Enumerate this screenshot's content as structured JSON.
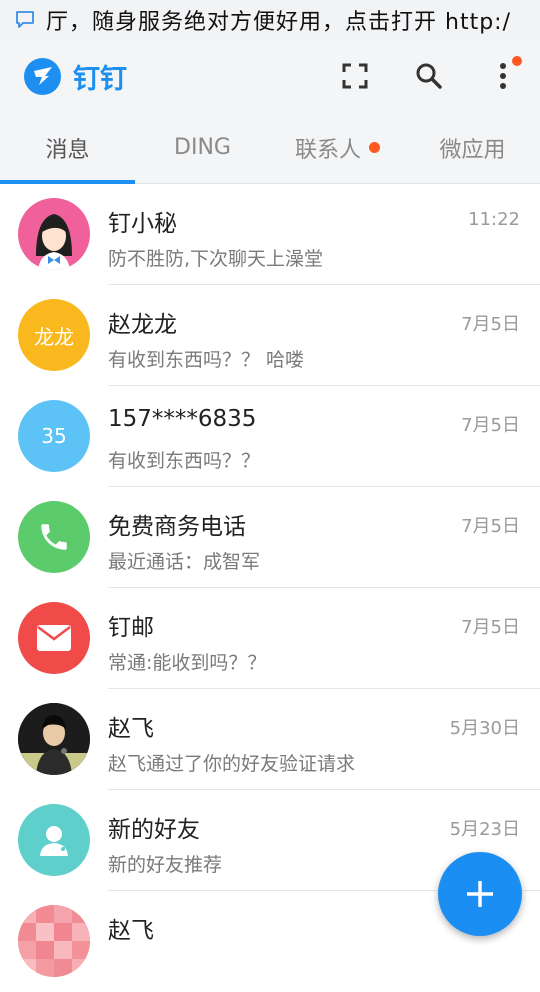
{
  "notification": {
    "text": "厅，随身服务绝对方便好用，点击打开 http:/",
    "icon": "chat-bubble-icon"
  },
  "appbar": {
    "title": "钉钉",
    "actions": [
      "fullscreen-icon",
      "search-icon",
      "more-vert-icon"
    ]
  },
  "tabs": [
    {
      "label": "消息",
      "active": true
    },
    {
      "label": "DING",
      "active": false
    },
    {
      "label": "联系人",
      "active": false,
      "badge": true
    },
    {
      "label": "微应用",
      "active": false
    }
  ],
  "conversations": [
    {
      "name": "钉小秘",
      "time": "11:22",
      "message": "防不胜防,下次聊天上澡堂",
      "avatar_color": "#f0609a"
    },
    {
      "name": "赵龙龙",
      "time": "7月5日",
      "message": "有收到东西吗？？ 哈喽",
      "avatar_text": "龙龙",
      "avatar_color": "#f9b91e"
    },
    {
      "name": "157****6835",
      "time": "7月5日",
      "message": "有收到东西吗？？",
      "avatar_text": "35",
      "avatar_color": "#5dc3f7"
    },
    {
      "name": "免费商务电话",
      "time": "7月5日",
      "message": "最近通话：成智军",
      "avatar_color": "#5ccb6b"
    },
    {
      "name": "钉邮",
      "time": "7月5日",
      "message": "常通:能收到吗？？",
      "avatar_color": "#f04a49"
    },
    {
      "name": "赵飞",
      "time": "5月30日",
      "message": "赵飞通过了你的好友验证请求",
      "avatar_color": "#2a2a2a"
    },
    {
      "name": "新的好友",
      "time": "5月23日",
      "message": "新的好友推荐",
      "avatar_color": "#5fcfcb"
    },
    {
      "name": "赵飞",
      "time": "",
      "message": "",
      "avatar_color": "#f59aa2"
    }
  ],
  "fab": {
    "icon": "plus-icon"
  }
}
